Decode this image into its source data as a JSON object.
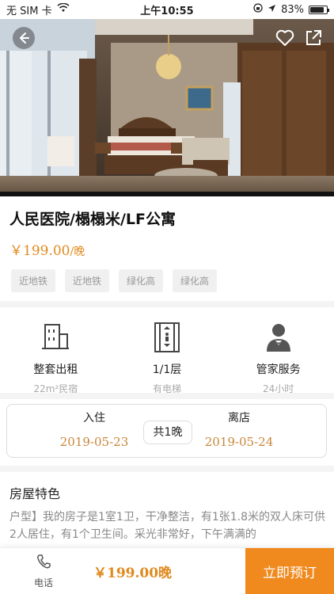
{
  "status_bar": {
    "carrier": "无 SIM 卡",
    "time": "上午10:55",
    "battery": "83%",
    "battery_level": 0.83
  },
  "hero": {
    "back_icon": "back-arrow-icon",
    "favorite_icon": "heart-icon",
    "share_icon": "share-icon"
  },
  "listing": {
    "title": "人民医院/榻榻米/LF公寓",
    "price": "￥199.00",
    "price_unit": "/晚",
    "tags": [
      "近地铁",
      "近地铁",
      "绿化高",
      "绿化高"
    ]
  },
  "features": [
    {
      "icon": "building-icon",
      "title": "整套出租",
      "subtitle": "22m²民宿"
    },
    {
      "icon": "elevator-icon",
      "title": "1/1层",
      "subtitle": "有电梯"
    },
    {
      "icon": "butler-icon",
      "title": "管家服务",
      "subtitle": "24小时"
    }
  ],
  "dates": {
    "checkin_label": "入住",
    "checkin_date": "2019-05-23",
    "nights": "共1晚",
    "checkout_label": "离店",
    "checkout_date": "2019-05-24"
  },
  "section": {
    "title": "房屋特色",
    "description": "户型】我的房子是1室1卫，干净整洁，有1张1.8米的双人床可供2人居住，有1个卫生间。采光非常好，下午满满的"
  },
  "bottom_bar": {
    "phone_label": "电话",
    "price": "￥199.00晚",
    "book_label": "立即预订"
  },
  "colors": {
    "accent": "#f08a1e",
    "price": "#e08a1e",
    "date": "#c8863a"
  }
}
